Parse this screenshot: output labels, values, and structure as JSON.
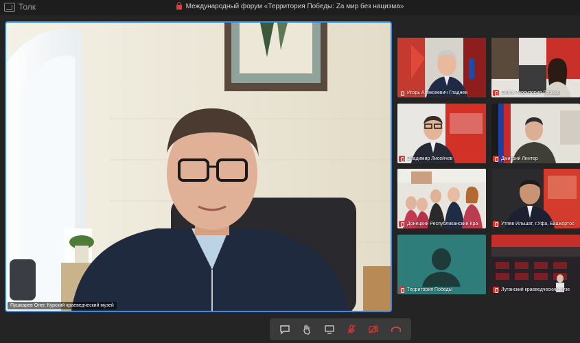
{
  "app": {
    "name": "Толк",
    "icon": "app-logo-icon"
  },
  "conference": {
    "title": "Международный форум «Территория Победы: Za мир без нацизма»",
    "lock_icon": "lock-icon"
  },
  "main_video": {
    "name": "Пушкарев Олег, Курский краеведческий музей"
  },
  "participants": [
    {
      "name": "Игорь Алексеевич Гладнев"
    },
    {
      "name": "Ольга Территория Победы"
    },
    {
      "name": "Владимир Лисейчев"
    },
    {
      "name": "Дмитрий Линтер"
    },
    {
      "name": "Донецкий Республиканский Кра"
    },
    {
      "name": "Утяев Ильшат, г.Уфа, Башкортос"
    },
    {
      "name": "Территория Победы"
    },
    {
      "name": "Луганский краеведческий музе"
    }
  ],
  "toolbar": {
    "buttons": [
      "chat-icon",
      "raise-hand-icon",
      "screen-share-icon",
      "microphone-muted-icon",
      "camera-muted-icon",
      "hang-up-icon"
    ]
  },
  "colors": {
    "accent": "#2d8cf0",
    "mic_muted": "#e0342e",
    "hangup": "#e04a3a"
  }
}
